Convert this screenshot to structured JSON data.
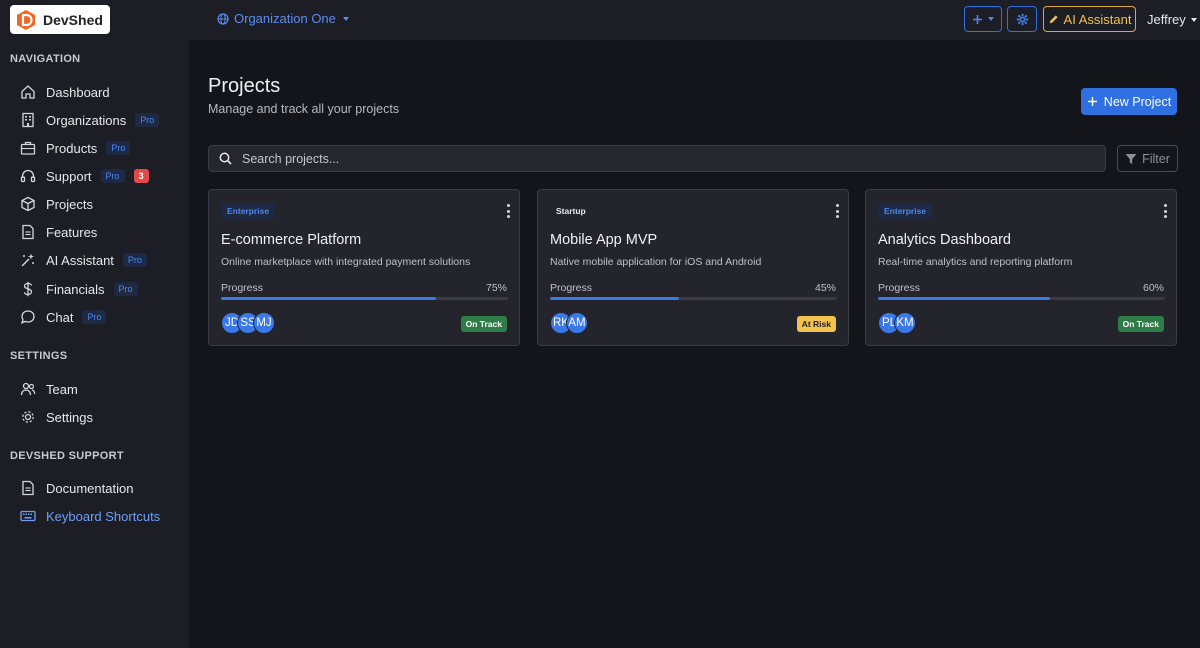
{
  "app": {
    "name": "DevShed"
  },
  "header": {
    "org_name": "Organization One",
    "ai_button": "AI Assistant",
    "user_name": "Jeffrey"
  },
  "sidebar": {
    "sections": [
      {
        "title": "NAVIGATION"
      },
      {
        "title": "SETTINGS"
      },
      {
        "title": "DEVSHED SUPPORT"
      }
    ],
    "items": [
      {
        "label": "Dashboard",
        "icon": "home-icon"
      },
      {
        "label": "Organizations",
        "icon": "building-icon",
        "badge": "Pro"
      },
      {
        "label": "Products",
        "icon": "briefcase-icon",
        "badge": "Pro"
      },
      {
        "label": "Support",
        "icon": "headset-icon",
        "badge": "Pro",
        "count": "3"
      },
      {
        "label": "Projects",
        "icon": "box-icon"
      },
      {
        "label": "Features",
        "icon": "document-icon"
      },
      {
        "label": "AI Assistant",
        "icon": "sparkle-icon",
        "badge": "Pro"
      },
      {
        "label": "Financials",
        "icon": "dollar-icon",
        "badge": "Pro"
      },
      {
        "label": "Chat",
        "icon": "chat-icon",
        "badge": "Pro"
      },
      {
        "label": "Team",
        "icon": "team-icon"
      },
      {
        "label": "Settings",
        "icon": "gear-icon"
      },
      {
        "label": "Documentation",
        "icon": "document-icon"
      },
      {
        "label": "Keyboard Shortcuts",
        "icon": "keyboard-icon",
        "active": true
      }
    ]
  },
  "main": {
    "title": "Projects",
    "subtitle": "Manage and track all your projects",
    "new_button": "New Project",
    "search_placeholder": "Search projects...",
    "filter_button": "Filter",
    "progress_label": "Progress",
    "projects": [
      {
        "tier": "Enterprise",
        "name": "E-commerce Platform",
        "description": "Online marketplace with integrated payment solutions",
        "progress": 75,
        "progress_text": "75%",
        "members": [
          "JD",
          "SS",
          "MJ"
        ],
        "status": "On Track"
      },
      {
        "tier": "Startup",
        "name": "Mobile App MVP",
        "description": "Native mobile application for iOS and Android",
        "progress": 45,
        "progress_text": "45%",
        "members": [
          "RK",
          "AM"
        ],
        "status": "At Risk"
      },
      {
        "tier": "Enterprise",
        "name": "Analytics Dashboard",
        "description": "Real-time analytics and reporting platform",
        "progress": 60,
        "progress_text": "60%",
        "members": [
          "PL",
          "KM"
        ],
        "status": "On Track"
      }
    ]
  },
  "colors": {
    "accent": "#2f6fe0",
    "warning": "#f2c14e",
    "success": "#2e7d46",
    "danger": "#e04a4a"
  }
}
